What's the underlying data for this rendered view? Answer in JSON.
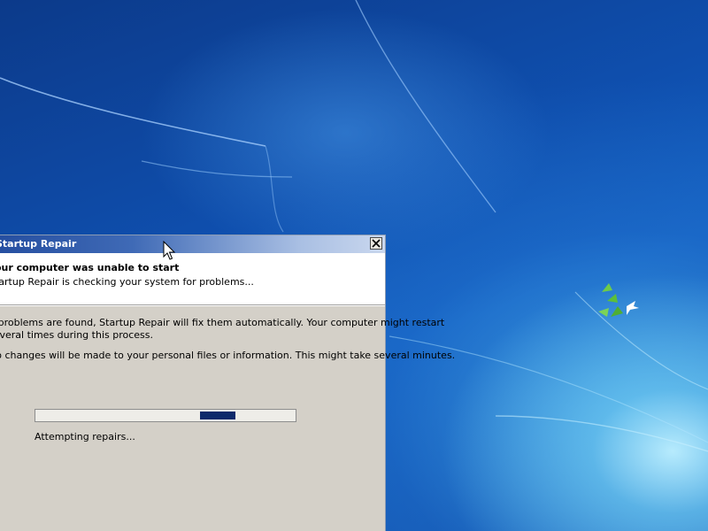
{
  "window": {
    "title": "Startup Repair",
    "close_icon": "close-icon"
  },
  "header": {
    "title": "Your computer was unable to start",
    "subtitle": "Startup Repair is checking your system for problems..."
  },
  "body": {
    "paragraph_line1": "If problems are found, Startup Repair will fix them automatically. Your computer might restart",
    "paragraph_line2": "several times during this process.",
    "paragraph2": "No changes will be made to your personal files or information. This might take several minutes."
  },
  "progress": {
    "style": "marquee",
    "indeterminate": true,
    "status": "Attempting repairs..."
  },
  "colors": {
    "desktop_blue": "#1360c2",
    "titlebar_start": "#254ea0",
    "titlebar_end": "#c9d7ee",
    "dialog_face": "#d4d0c8",
    "progress_chunk": "#0d2a6b"
  },
  "icons": {
    "cursor": "mouse-pointer-icon",
    "logo": "windows-7-wallpaper-bird-icon"
  }
}
